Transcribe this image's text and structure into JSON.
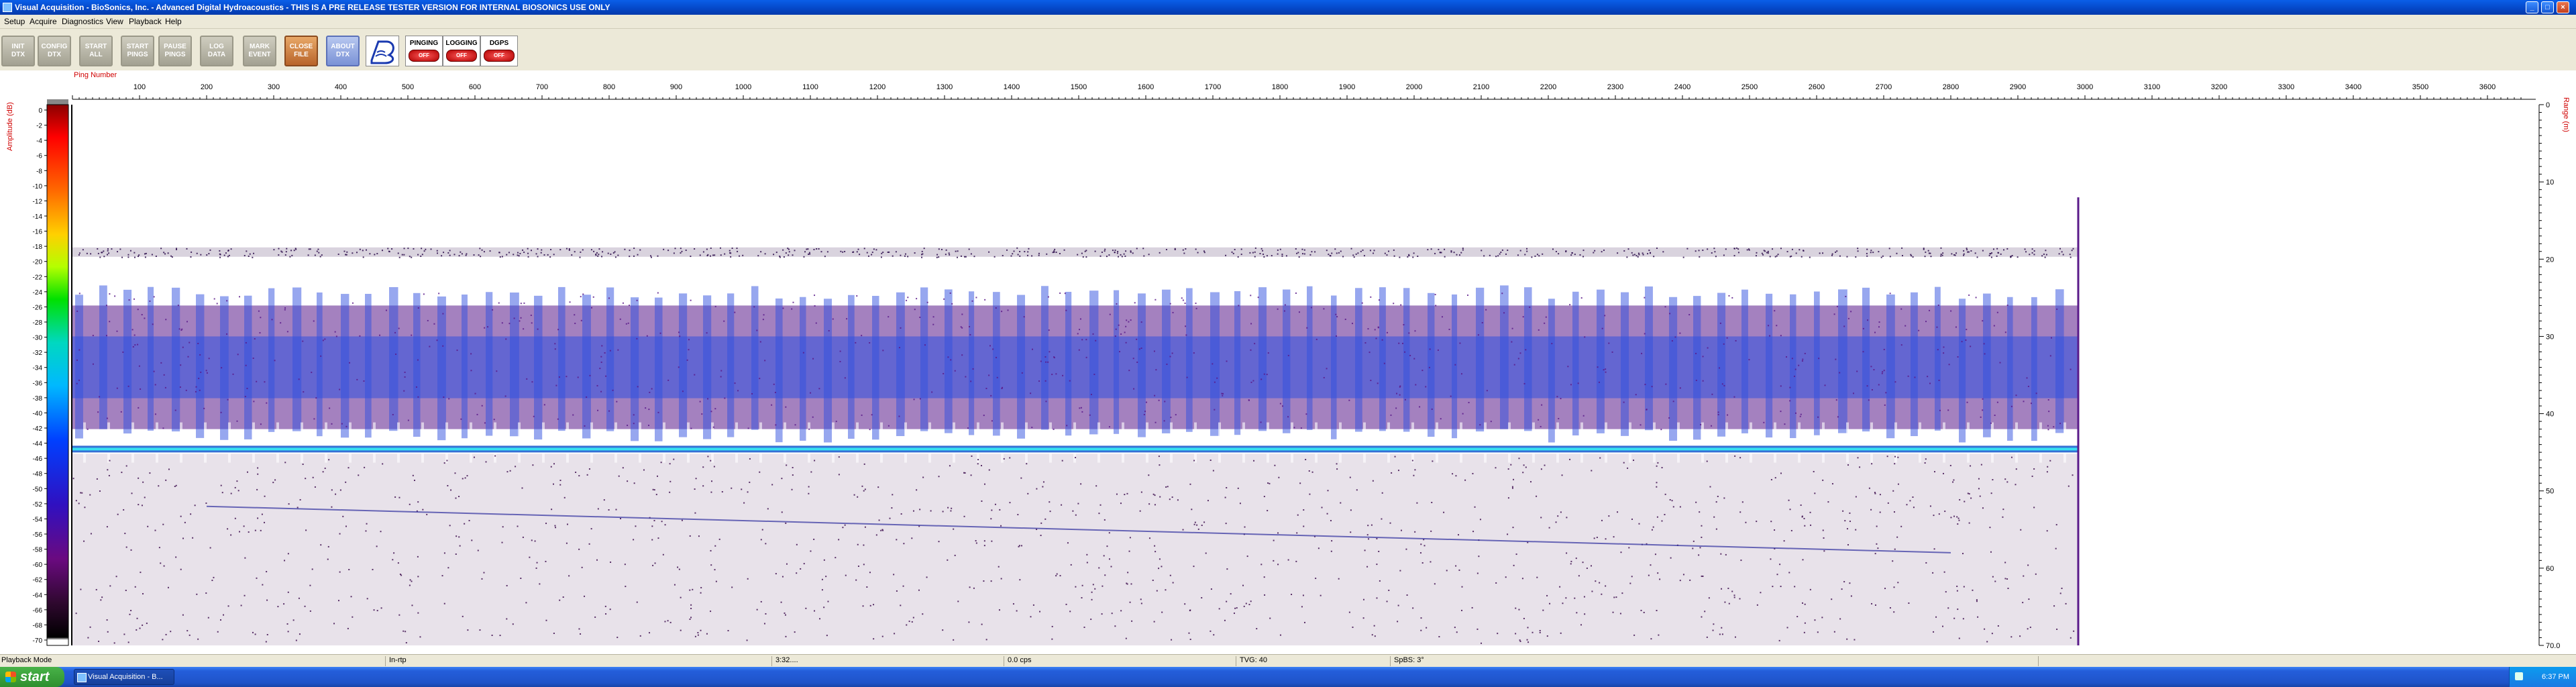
{
  "window": {
    "title": "Visual Acquisition  -  BioSonics, Inc.  -  Advanced Digital Hydroacoustics  -  THIS IS A PRE RELEASE TESTER VERSION FOR INTERNAL BIOSONICS USE ONLY",
    "minimize": "_",
    "maximize": "□",
    "close": "×"
  },
  "menu": [
    "Setup",
    "Acquire",
    "Diagnostics",
    "View",
    "Playback",
    "Help"
  ],
  "toolbar": {
    "buttons": [
      {
        "label": "INIT\nDTX",
        "style": "gray"
      },
      {
        "label": "CONFIG\nDTX",
        "style": "gray"
      },
      {
        "label": "START\nALL",
        "style": "gray"
      },
      {
        "label": "START\nPINGS",
        "style": "gray"
      },
      {
        "label": "PAUSE\nPINGS",
        "style": "gray"
      },
      {
        "label": "LOG\nDATA",
        "style": "gray"
      },
      {
        "label": "MARK\nEVENT",
        "style": "gray"
      },
      {
        "label": "CLOSE\nFILE",
        "style": "orange"
      },
      {
        "label": "ABOUT\nDTX",
        "style": "blue"
      }
    ],
    "status": [
      {
        "label": "PINGING",
        "state": "OFF"
      },
      {
        "label": "LOGGING",
        "state": "OFF"
      },
      {
        "label": "DGPS",
        "state": "OFF"
      }
    ]
  },
  "echogram": {
    "x_axis_label": "Ping Number",
    "x_ticks": [
      "100",
      "200",
      "300",
      "400",
      "500",
      "600",
      "700",
      "800",
      "900",
      "1000",
      "1100",
      "1200",
      "1300",
      "1400",
      "1500",
      "1600",
      "1700",
      "1800",
      "1900",
      "2000",
      "2100",
      "2200",
      "2300",
      "2400",
      "2500",
      "2600",
      "2700",
      "2800",
      "2900",
      "3000",
      "3100",
      "3200",
      "3300",
      "3400",
      "3500",
      "3600"
    ],
    "colorbar_label": "Amplitude (dB)",
    "colorbar_ticks": [
      "0",
      "-2",
      "-4",
      "-6",
      "-8",
      "-10",
      "-12",
      "-14",
      "-16",
      "-18",
      "-20",
      "-22",
      "-24",
      "-26",
      "-28",
      "-30",
      "-32",
      "-34",
      "-36",
      "-38",
      "-40",
      "-42",
      "-44",
      "-46",
      "-48",
      "-50",
      "-52",
      "-54",
      "-56",
      "-58",
      "-60",
      "-62",
      "-64",
      "-66",
      "-68",
      "-70"
    ],
    "y_axis_label": "Range (m)",
    "y_ticks": [
      "0",
      "10",
      "20",
      "30",
      "40",
      "50",
      "60",
      "70.0"
    ],
    "pings_recorded": 2990,
    "range_max_m": 70,
    "surface_layer_depth_m": 19,
    "fish_layer_depth_m": [
      26,
      42
    ],
    "bottom_depth_m": 44.5,
    "colors": {
      "surface": "#2a0a4a",
      "fish_dense": "#3050e0",
      "fish_sparse": "#5a1a8a",
      "bottom_bright": "#38e0f0",
      "bottom_band": "#2060d0",
      "deep_noise": "#401050"
    }
  },
  "statusbar": {
    "fields": [
      "Playback Mode",
      "In-rtp",
      "3:32....",
      "0.0 cps",
      "TVG: 40",
      "SpBS: 3°"
    ]
  },
  "taskbar": {
    "start": "start",
    "task": "Visual Acquisition - B...",
    "clock": "6:37 PM"
  }
}
